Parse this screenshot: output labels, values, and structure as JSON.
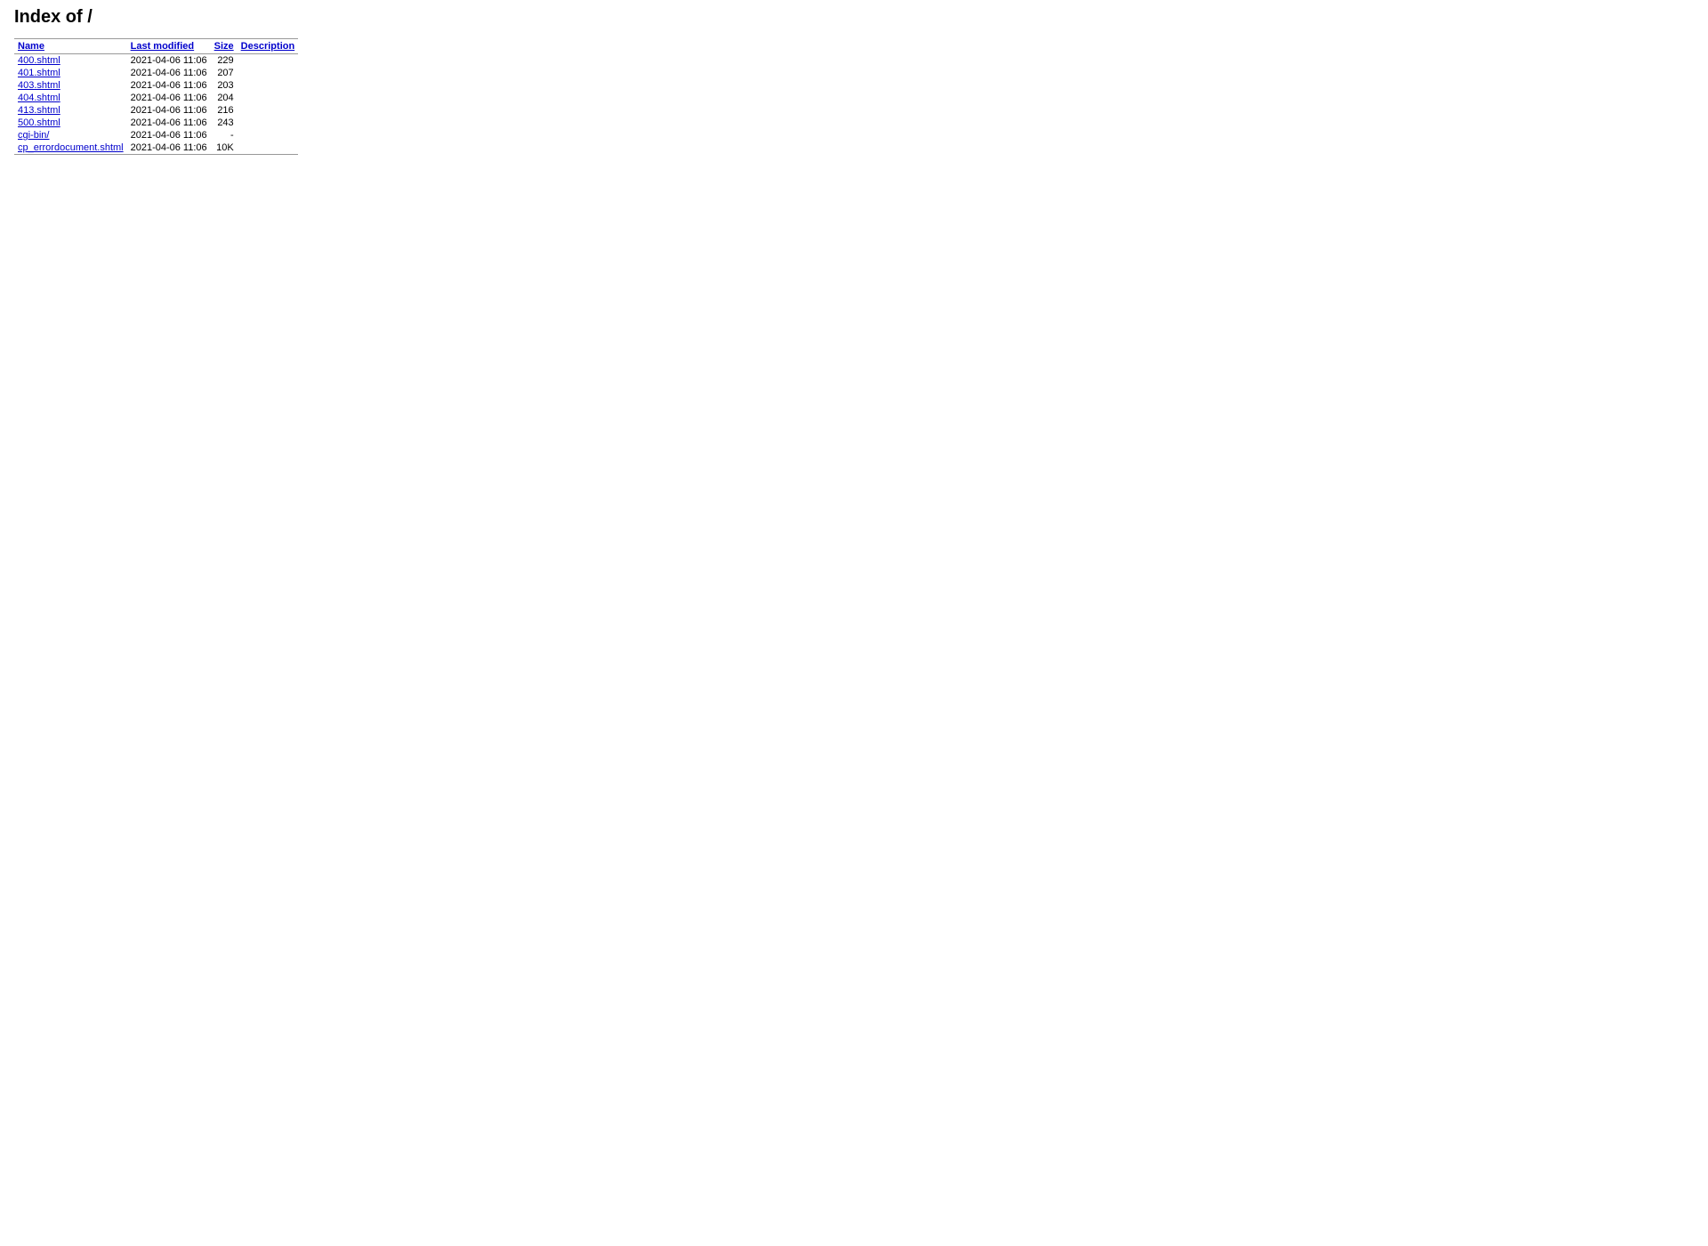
{
  "page": {
    "title": "Index of /"
  },
  "table": {
    "headers": {
      "name": "Name",
      "last_modified": "Last modified",
      "size": "Size",
      "description": "Description"
    },
    "rows": [
      {
        "name": "400.shtml",
        "modified": "2021-04-06 11:06",
        "size": "229",
        "description": "",
        "is_dir": false
      },
      {
        "name": "401.shtml",
        "modified": "2021-04-06 11:06",
        "size": "207",
        "description": "",
        "is_dir": false
      },
      {
        "name": "403.shtml",
        "modified": "2021-04-06 11:06",
        "size": "203",
        "description": "",
        "is_dir": false
      },
      {
        "name": "404.shtml",
        "modified": "2021-04-06 11:06",
        "size": "204",
        "description": "",
        "is_dir": false
      },
      {
        "name": "413.shtml",
        "modified": "2021-04-06 11:06",
        "size": "216",
        "description": "",
        "is_dir": false
      },
      {
        "name": "500.shtml",
        "modified": "2021-04-06 11:06",
        "size": "243",
        "description": "",
        "is_dir": false
      },
      {
        "name": "cgi-bin/",
        "modified": "2021-04-06 11:06",
        "size": "-",
        "description": "",
        "is_dir": true
      },
      {
        "name": "cp_errordocument.shtml",
        "modified": "2021-04-06 11:06",
        "size": "10K",
        "description": "",
        "is_dir": false
      }
    ]
  }
}
